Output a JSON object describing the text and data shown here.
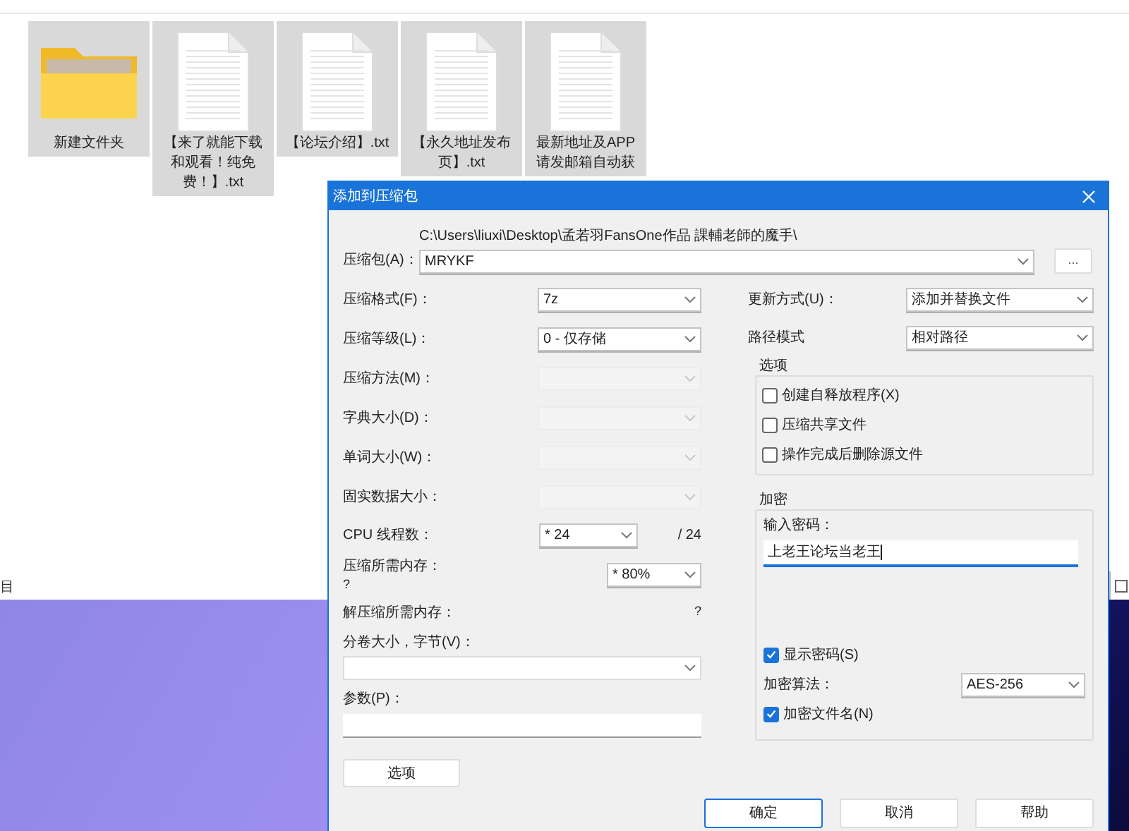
{
  "explorer": {
    "files": [
      {
        "name": "新建文件夹",
        "kind": "folder"
      },
      {
        "name": "【来了就能下载和观看！纯免费！】.txt",
        "kind": "text"
      },
      {
        "name": "【论坛介绍】.txt",
        "kind": "text"
      },
      {
        "name": "【永久地址发布页】.txt",
        "kind": "text"
      },
      {
        "name": "最新地址及APP请发邮箱自动获",
        "kind": "text"
      }
    ],
    "status_text": "目"
  },
  "dialog": {
    "title": "添加到压缩包",
    "archive": {
      "label": "压缩包(A)：",
      "path": "C:\\Users\\liuxi\\Desktop\\孟若羽FansOne作品 課輔老師的魔手\\",
      "value": "MRYKF"
    },
    "browse_button": "...",
    "settings": [
      {
        "label": "压缩格式(F)：",
        "value": "7z",
        "disabled": false
      },
      {
        "label": "压缩等级(L)：",
        "value": "0 - 仅存储",
        "disabled": false
      },
      {
        "label": "压缩方法(M)：",
        "disabled": true
      },
      {
        "label": "字典大小(D)：",
        "disabled": true
      },
      {
        "label": "单词大小(W)：",
        "disabled": true
      },
      {
        "label": "固实数据大小：",
        "disabled": true
      }
    ],
    "cpu": {
      "label": "CPU 线程数：",
      "value": "* 24",
      "max": "/ 24"
    },
    "memory": {
      "label": "压缩所需内存：",
      "note": "?",
      "value": "* 80%"
    },
    "decompress_memory": {
      "label": "解压缩所需内存：",
      "value": "?"
    },
    "volume": {
      "label": "分卷大小，字节(V)："
    },
    "params": {
      "label": "参数(P)："
    },
    "options_button": "选项",
    "update": {
      "label": "更新方式(U)：",
      "value": "添加并替换文件"
    },
    "path_mode": {
      "label": "路径模式",
      "value": "相对路径"
    },
    "options_group": {
      "title": "选项",
      "items": [
        {
          "label": "创建自释放程序(X)",
          "checked": false
        },
        {
          "label": "压缩共享文件",
          "checked": false
        },
        {
          "label": "操作完成后删除源文件",
          "checked": false
        }
      ]
    },
    "encryption": {
      "title": "加密",
      "password_label": "输入密码：",
      "password": "上老王论坛当老王",
      "show_password": {
        "label": "显示密码(S)",
        "checked": true
      },
      "method": {
        "label": "加密算法：",
        "value": "AES-256"
      },
      "encrypt_names": {
        "label": "加密文件名(N)",
        "checked": true
      }
    },
    "buttons": [
      {
        "label": "确定",
        "selected": true
      },
      {
        "label": "取消",
        "selected": false
      },
      {
        "label": "帮助",
        "selected": false
      }
    ]
  }
}
